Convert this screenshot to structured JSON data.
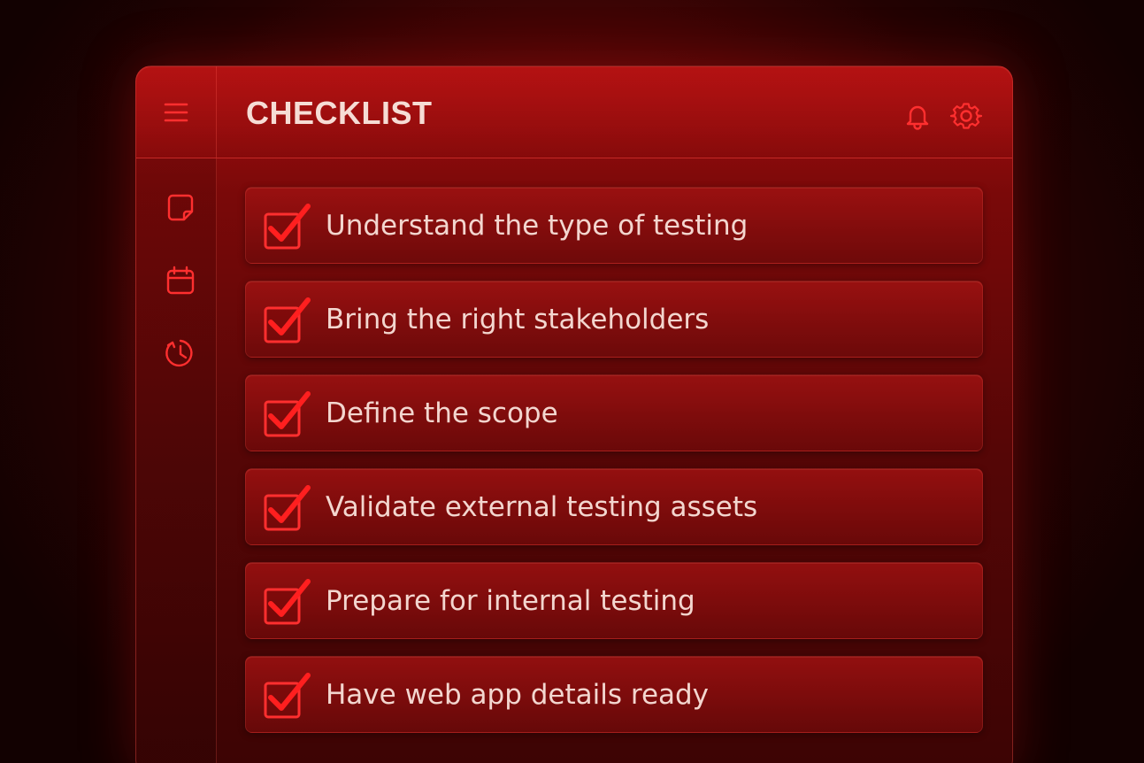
{
  "header": {
    "title": "CHECKLIST",
    "menu_icon": "hamburger-menu-icon",
    "actions": [
      {
        "name": "notifications-button",
        "icon": "bell-icon"
      },
      {
        "name": "settings-button",
        "icon": "gear-icon"
      }
    ]
  },
  "sidebar": {
    "items": [
      {
        "name": "sidebar-item-notes",
        "icon": "note-icon"
      },
      {
        "name": "sidebar-item-calendar",
        "icon": "calendar-icon"
      },
      {
        "name": "sidebar-item-history",
        "icon": "clock-icon"
      }
    ]
  },
  "checklist": {
    "items": [
      {
        "label": "Understand the type of testing",
        "checked": true
      },
      {
        "label": "Bring the right stakeholders",
        "checked": true
      },
      {
        "label": "Define the scope",
        "checked": true
      },
      {
        "label": "Validate external testing assets",
        "checked": true
      },
      {
        "label": "Prepare for internal testing",
        "checked": true
      },
      {
        "label": "Have web app details ready",
        "checked": true
      }
    ]
  },
  "colors": {
    "accent": "#ff2a2a",
    "text": "#f3d6cf",
    "panel": "#7a0909",
    "background": "#140101"
  }
}
